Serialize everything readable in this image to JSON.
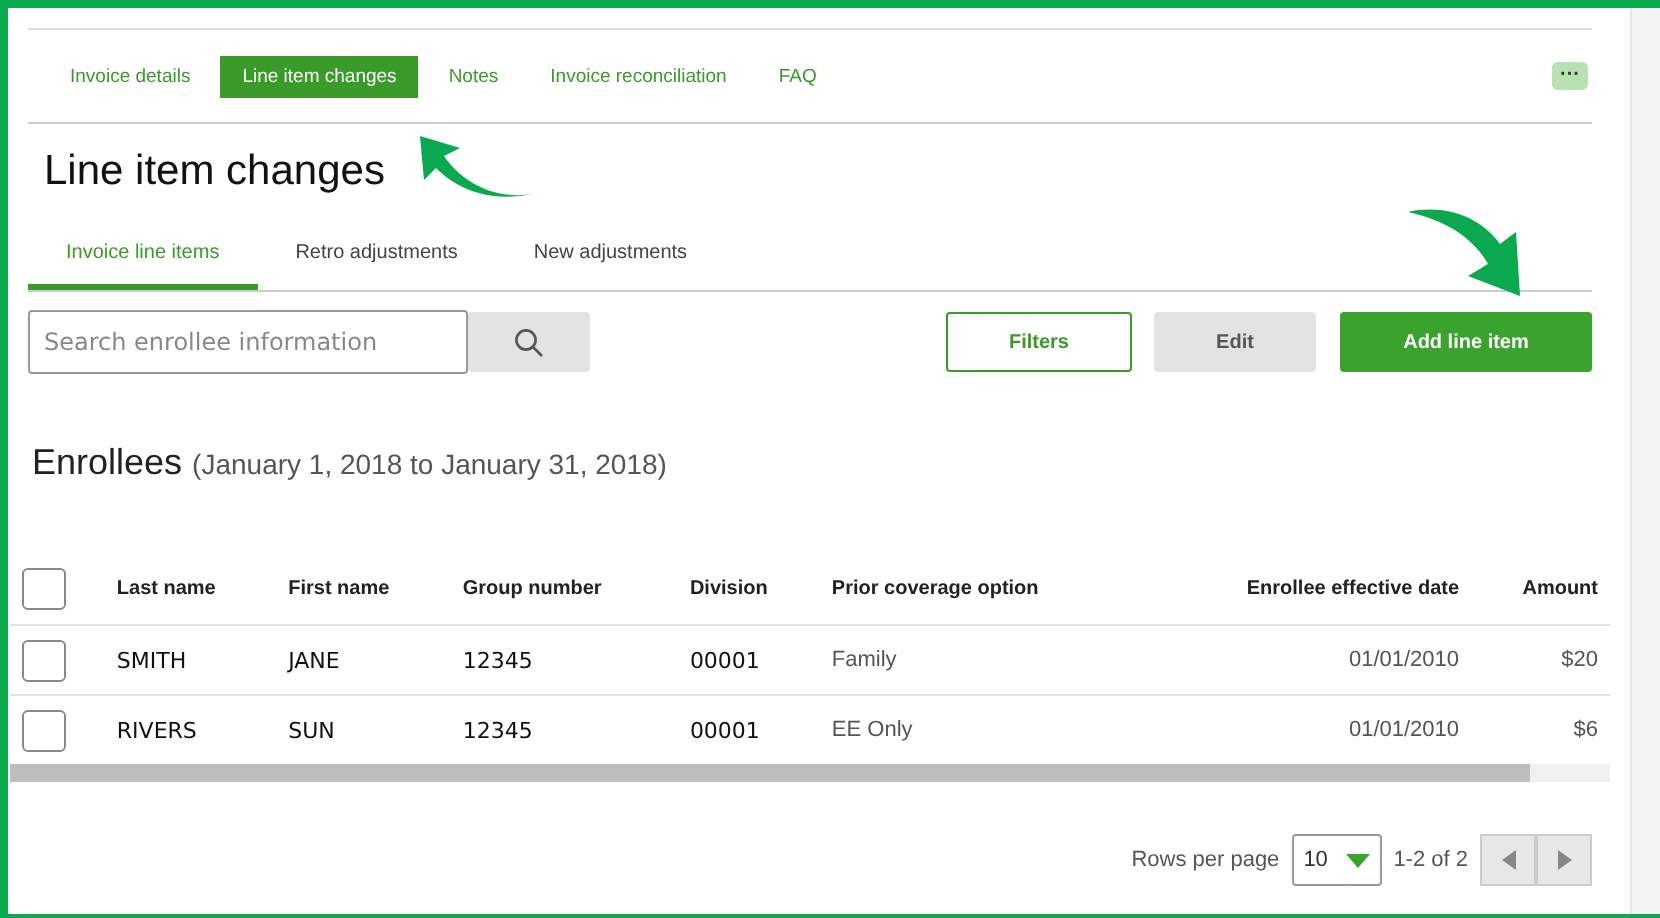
{
  "nav_tabs": [
    {
      "label": "Invoice details",
      "selected": false
    },
    {
      "label": "Line item changes",
      "selected": true
    },
    {
      "label": "Notes",
      "selected": false
    },
    {
      "label": "Invoice reconciliation",
      "selected": false
    },
    {
      "label": "FAQ",
      "selected": false
    }
  ],
  "more_button": "···",
  "page_title": "Line item changes",
  "sub_tabs": [
    {
      "label": "Invoice line items",
      "selected": true
    },
    {
      "label": "Retro adjustments",
      "selected": false
    },
    {
      "label": "New adjustments",
      "selected": false
    }
  ],
  "search": {
    "placeholder": "Search enrollee information"
  },
  "buttons": {
    "filters": "Filters",
    "edit": "Edit",
    "add": "Add line item"
  },
  "section_title": "Enrollees",
  "section_range": "(January 1, 2018 to January 31, 2018)",
  "table": {
    "select_all_checked": false,
    "columns": [
      "Last name",
      "First name",
      "Group number",
      "Division",
      "Prior coverage option",
      "Enrollee effective date",
      "Amount"
    ],
    "rows": [
      {
        "checked": false,
        "cells": [
          "SMITH",
          "JANE",
          "12345",
          "00001",
          "Family",
          "01/01/2010",
          "$20"
        ]
      },
      {
        "checked": false,
        "cells": [
          "RIVERS",
          "SUN",
          "12345",
          "00001",
          "EE Only",
          "01/01/2010",
          "$6"
        ]
      }
    ]
  },
  "pagination": {
    "rows_label": "Rows per page",
    "rows_value": "10",
    "range": "1-2 of 2"
  }
}
